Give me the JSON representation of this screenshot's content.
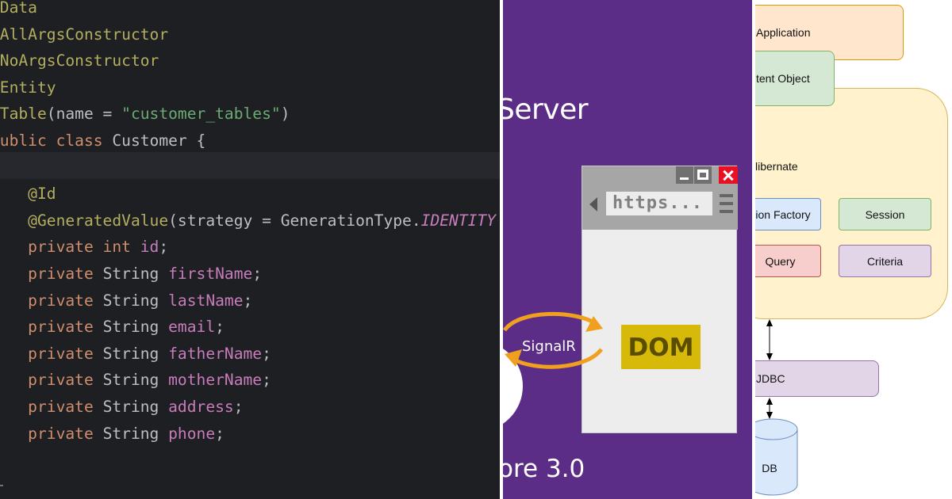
{
  "code_editor": {
    "lines": [
      [
        {
          "t": "@Data",
          "c": "ann"
        }
      ],
      [
        {
          "t": "@AllArgsConstructor",
          "c": "ann"
        }
      ],
      [
        {
          "t": "@NoArgsConstructor",
          "c": "ann"
        }
      ],
      [
        {
          "t": "@Entity",
          "c": "ann"
        }
      ],
      [
        {
          "t": "@Table",
          "c": "ann"
        },
        {
          "t": "(name = ",
          "c": "plain"
        },
        {
          "t": "\"customer_tables\"",
          "c": "str"
        },
        {
          "t": ")",
          "c": "plain"
        }
      ],
      [
        {
          "t": "public class ",
          "c": "kw"
        },
        {
          "t": "Customer {",
          "c": "plain"
        }
      ],
      [],
      [
        {
          "t": "    @Id",
          "c": "ann"
        }
      ],
      [
        {
          "t": "    @GeneratedValue",
          "c": "ann"
        },
        {
          "t": "(strategy = GenerationType.",
          "c": "plain"
        },
        {
          "t": "IDENTITY",
          "c": "const"
        }
      ],
      [
        {
          "t": "    private int ",
          "c": "kw"
        },
        {
          "t": "id",
          "c": "field"
        },
        {
          "t": ";",
          "c": "plain"
        }
      ],
      [
        {
          "t": "    private ",
          "c": "kw"
        },
        {
          "t": "String ",
          "c": "plain"
        },
        {
          "t": "firstName",
          "c": "field"
        },
        {
          "t": ";",
          "c": "plain"
        }
      ],
      [
        {
          "t": "    private ",
          "c": "kw"
        },
        {
          "t": "String ",
          "c": "plain"
        },
        {
          "t": "lastName",
          "c": "field"
        },
        {
          "t": ";",
          "c": "plain"
        }
      ],
      [
        {
          "t": "    private ",
          "c": "kw"
        },
        {
          "t": "String ",
          "c": "plain"
        },
        {
          "t": "email",
          "c": "field"
        },
        {
          "t": ";",
          "c": "plain"
        }
      ],
      [
        {
          "t": "    private ",
          "c": "kw"
        },
        {
          "t": "String ",
          "c": "plain"
        },
        {
          "t": "fatherName",
          "c": "field"
        },
        {
          "t": ";",
          "c": "plain"
        }
      ],
      [
        {
          "t": "    private ",
          "c": "kw"
        },
        {
          "t": "String ",
          "c": "plain"
        },
        {
          "t": "motherName",
          "c": "field"
        },
        {
          "t": ";",
          "c": "plain"
        }
      ],
      [
        {
          "t": "    private ",
          "c": "kw"
        },
        {
          "t": "String ",
          "c": "plain"
        },
        {
          "t": "address",
          "c": "field"
        },
        {
          "t": ";",
          "c": "plain"
        }
      ],
      [
        {
          "t": "    private ",
          "c": "kw"
        },
        {
          "t": "String ",
          "c": "plain"
        },
        {
          "t": "phone",
          "c": "field"
        },
        {
          "t": ";",
          "c": "plain"
        }
      ]
    ],
    "colors": {
      "background": "#1e1f22",
      "annotation": "#b3ae60",
      "string": "#6aab73",
      "keyword": "#cf8e6d",
      "field": "#c77dbb",
      "plain": "#bcbec4"
    }
  },
  "blazor_slide": {
    "title": "Server",
    "subtitle": "ore 3.0",
    "address_text": "https...",
    "dom_label": "DOM",
    "signalr_label": "SignalR",
    "colors": {
      "background": "#5c2d86",
      "dom": "#d7b90a",
      "arrows": "#f0a01e",
      "close": "#e81123"
    }
  },
  "hibernate_diagram": {
    "application": "Application",
    "persistent_object": "tent Object",
    "hibernate": "libernate",
    "session_factory": "sion Factory",
    "session": "Session",
    "query": "Query",
    "criteria": "Criteria",
    "jdbc": "JDBC",
    "db": "DB"
  }
}
